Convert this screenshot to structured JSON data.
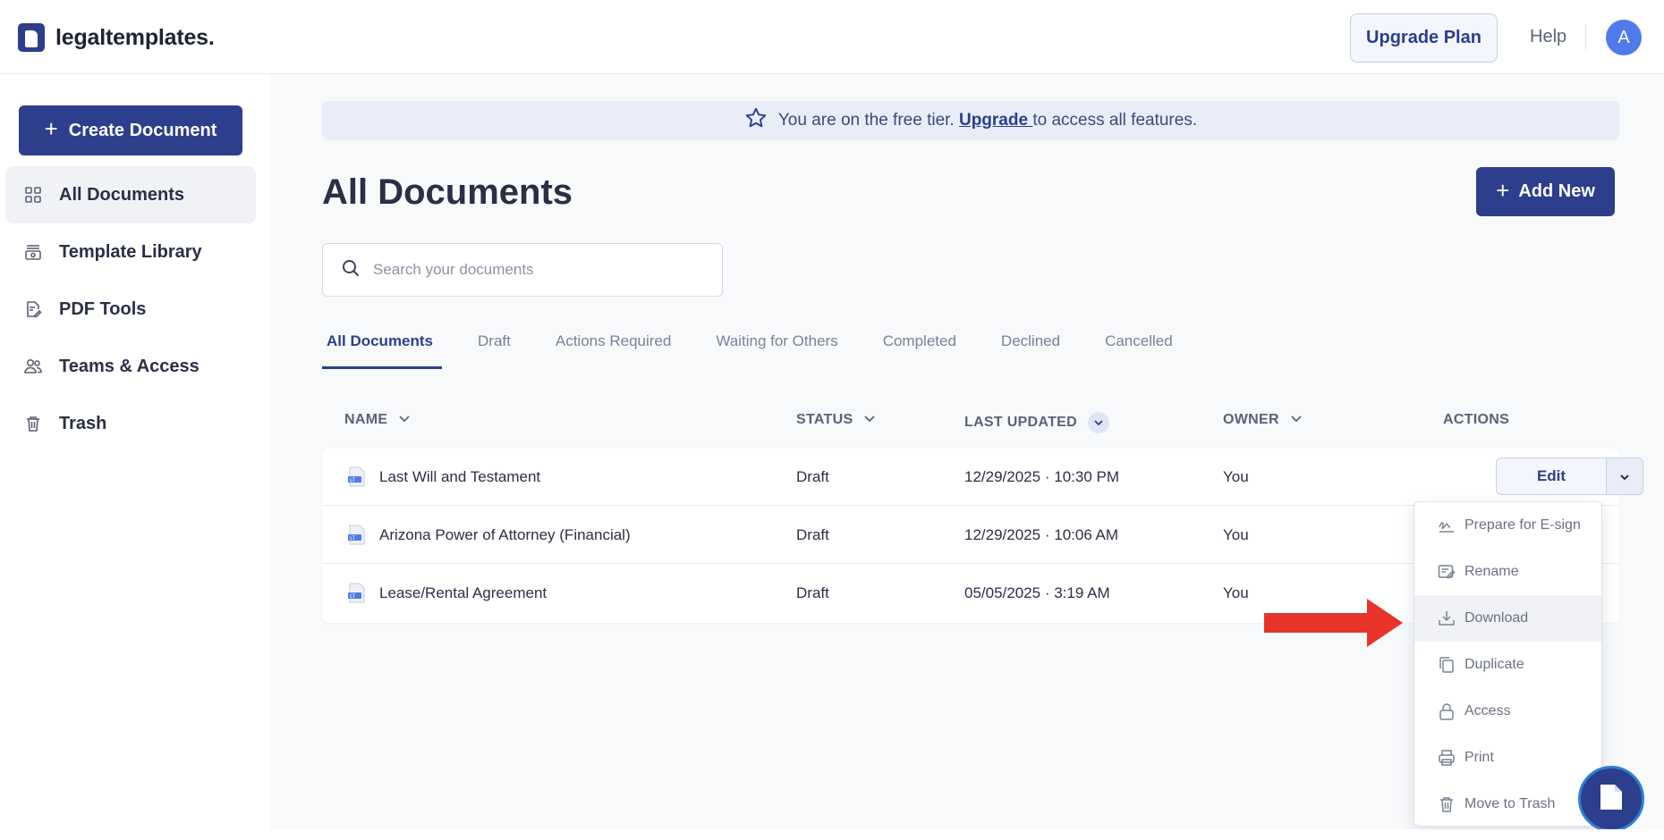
{
  "header": {
    "brand": "legaltemplates.",
    "upgrade_label": "Upgrade Plan",
    "help_label": "Help",
    "avatar_initial": "A"
  },
  "sidebar": {
    "create_label": "Create Document",
    "items": [
      {
        "label": "All Documents",
        "icon": "grid-icon"
      },
      {
        "label": "Template Library",
        "icon": "library-icon"
      },
      {
        "label": "PDF Tools",
        "icon": "pdf-edit-icon"
      },
      {
        "label": "Teams & Access",
        "icon": "users-icon"
      },
      {
        "label": "Trash",
        "icon": "trash-icon"
      }
    ]
  },
  "banner": {
    "text_before": "You are on the free tier.",
    "link": "Upgrade ",
    "text_after": "to access all features."
  },
  "main": {
    "title": "All Documents",
    "add_new_label": "Add New",
    "search_placeholder": "Search your documents",
    "tabs": [
      "All Documents",
      "Draft",
      "Actions Required",
      "Waiting for Others",
      "Completed",
      "Declined",
      "Cancelled"
    ],
    "columns": {
      "name": "NAME",
      "status": "STATUS",
      "last_updated": "LAST UPDATED",
      "owner": "OWNER",
      "actions": "ACTIONS"
    },
    "rows": [
      {
        "name": "Last Will and Testament",
        "status": "Draft",
        "date": "12/29/2025",
        "time": "10:30 PM",
        "owner": "You"
      },
      {
        "name": "Arizona Power of Attorney (Financial)",
        "status": "Draft",
        "date": "12/29/2025",
        "time": "10:06 AM",
        "owner": "You"
      },
      {
        "name": "Lease/Rental Agreement",
        "status": "Draft",
        "date": "05/05/2025",
        "time": "3:19 AM",
        "owner": "You"
      }
    ],
    "edit_label": "Edit",
    "date_separator": "·"
  },
  "menu": {
    "items": [
      {
        "label": "Prepare for E-sign",
        "icon": "signature-icon"
      },
      {
        "label": "Rename",
        "icon": "rename-icon"
      },
      {
        "label": "Download",
        "icon": "download-icon"
      },
      {
        "label": "Duplicate",
        "icon": "duplicate-icon"
      },
      {
        "label": "Access",
        "icon": "lock-icon"
      },
      {
        "label": "Print",
        "icon": "printer-icon"
      },
      {
        "label": "Move to Trash",
        "icon": "trash-icon"
      }
    ]
  },
  "colors": {
    "brand": "#2c3e8c",
    "avatar": "#4e7be9",
    "annotation_arrow": "#e8332a"
  }
}
